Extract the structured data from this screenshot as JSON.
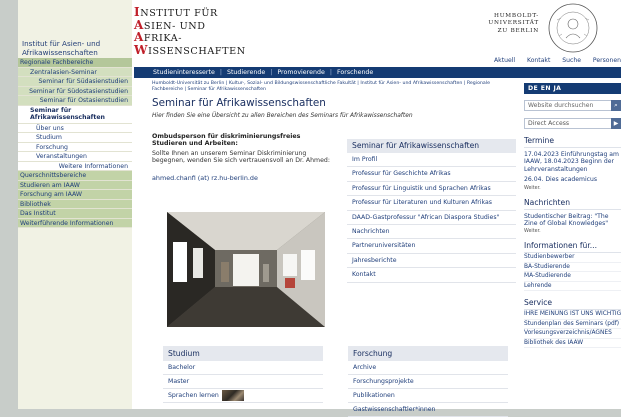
{
  "site": {
    "title": "Institut für Asien- und Afrikawissenschaften",
    "logo_lines": [
      {
        "cap": "I",
        "rest": "NSTITUT FÜR"
      },
      {
        "cap": "A",
        "rest": "SIEN- UND"
      },
      {
        "cap": "A",
        "rest": "FRIKA-"
      },
      {
        "cap": "W",
        "rest": "ISSENSCHAFTEN"
      }
    ],
    "university_lines": [
      "HUMBOLDT-",
      "UNIVERSITÄT",
      "ZU BERLIN"
    ]
  },
  "utility_nav": [
    "Aktuell",
    "Kontakt",
    "Suche",
    "Personen"
  ],
  "main_nav": [
    "Studieninteresserte",
    "Studierende",
    "Promovierende",
    "Forschende"
  ],
  "sidebar": {
    "regional_heading": "Regionale Fachbereiche",
    "regional_items": [
      "Zentralasien-Seminar",
      "Seminar für Südasienstudien",
      "Seminar für Südostasienstudien",
      "Seminar für Ostasienstudien"
    ],
    "active_item": "Seminar für Afrikawissenschaften",
    "active_subitems": [
      "Über uns",
      "Studium",
      "Forschung",
      "Veranstaltungen"
    ],
    "active_subitem_more": "Weitere Informationen",
    "main_items": [
      "Querschnittsbereiche",
      "Studieren am IAAW",
      "Forschung am IAAW",
      "Bibliothek",
      "Das Institut",
      "Weiterführende Informationen"
    ]
  },
  "breadcrumb": "Humboldt-Universität zu Berlin | Kultur-, Sozial- und Bildungswissenschaftliche Fakultät | Institut für Asien- und Afrikawissenschaften | Regionale Fachbereiche | Seminar für Afrikawissenschaften",
  "page_title": "Seminar für Afrikawissenschaften",
  "intro": "Hier finden Sie eine Übersicht zu allen Bereichen des Seminars für Afrikawissenschaften",
  "ombuds": {
    "title": "Ombudsperson für diskriminierungsfreies Studieren und Arbeiten:",
    "text": "Sollte Ihnen an unserem Seminar Diskriminierung begegnen, wenden Sie sich vertrauensvoll an Dr. Ahmed:",
    "email": "ahmed.chanfi (at) rz.hu-berlin.de"
  },
  "seminar_box": {
    "title": "Seminar für Afrikawissenschaften",
    "links": [
      "Im Profil",
      "Professur für Geschichte Afrikas",
      "Professur für Linguistik und Sprachen Afrikas",
      "Professur für Literaturen und Kulturen Afrikas",
      "DAAD-Gastprofessur \"African Diaspora Studies\"",
      "Nachrichten",
      "Partneruniversitäten",
      "Jahresberichte",
      "Kontakt"
    ]
  },
  "studium_box": {
    "title": "Studium",
    "links": [
      "Bachelor",
      "Master",
      "Sprachen lernen"
    ]
  },
  "forschung_box": {
    "title": "Forschung",
    "links": [
      "Archive",
      "Forschungsprojekte",
      "Publikationen",
      "Gastwissenschaftler*innen"
    ]
  },
  "right": {
    "lang": "DE  EN  JA",
    "search_placeholder": "Website durchsuchen",
    "direct_access": "Direct Access",
    "termine_title": "Termine",
    "termine_text": "17.04.2023 Einführungstag am IAAW, 18.04.2023 Beginn der Lehrveranstaltungen",
    "dies_text": "26.04. Dies academicus",
    "more1": "Weiter.",
    "nachrichten_title": "Nachrichten",
    "nachrichten_text": "Studentischer Beitrag: \"The Zine of Global Knowledges\"",
    "more2": "Weiter.",
    "info_title": "Informationen für...",
    "info_links": [
      "Studienbewerber",
      "BA-Studierende",
      "MA-Studierende",
      "Lehrende"
    ],
    "service_title": "Service",
    "service_links": [
      "IHRE MEINUNG IST UNS WICHTIG",
      "Stundenplan des Seminars (pdf)",
      "Vorlesungsverzeichnis/AGNES",
      "Bibliothek des IAAW"
    ]
  },
  "colors": {
    "navy": "#143b73",
    "sidebar_green": "#b4c79a",
    "logo_red": "#c0202a"
  }
}
